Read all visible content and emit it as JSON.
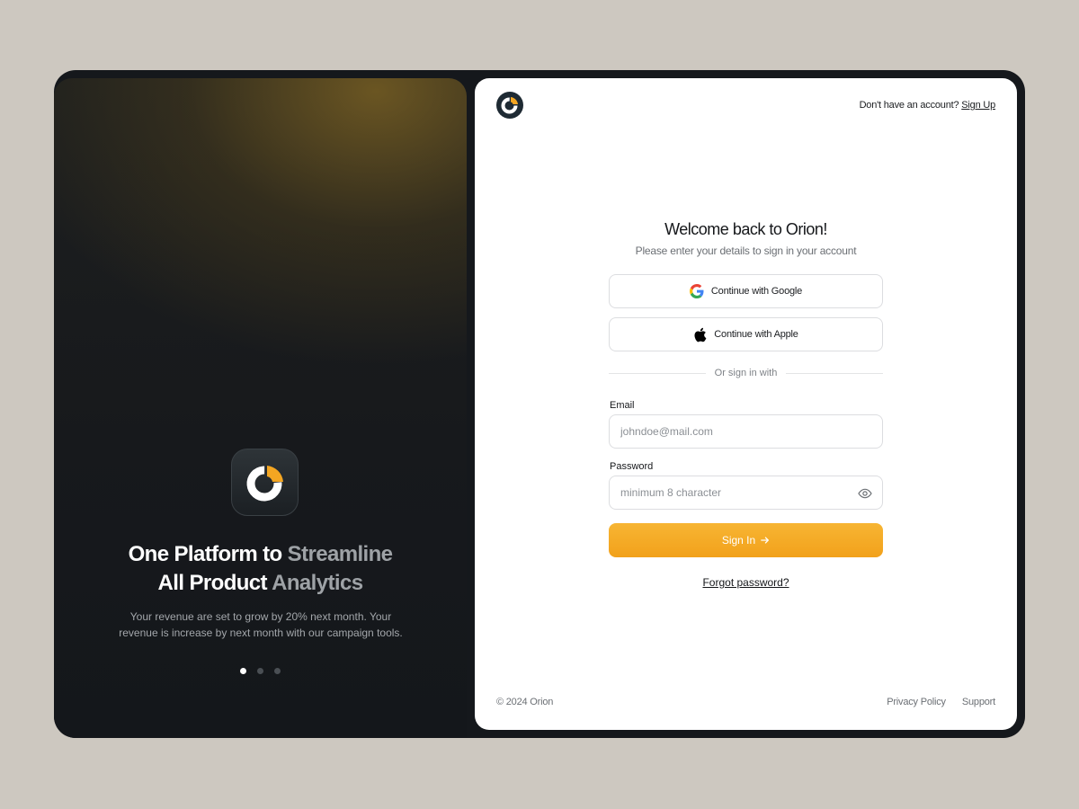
{
  "hero": {
    "headline_line1_a": "One Platform to",
    "headline_line1_b": "Streamline",
    "headline_line2_a": "All Product",
    "headline_line2_b": "Analytics",
    "description": "Your revenue are set to grow by 20% next month. Your revenue is increase by next month with our campaign tools.",
    "carousel_dots": 3,
    "carousel_active_index": 0
  },
  "header": {
    "signup_prompt": "Don't have an account?",
    "signup_link": "Sign Up"
  },
  "form": {
    "title": "Welcome back to Orion!",
    "subtitle": "Please enter your details to sign in your account",
    "google_label": "Continue with Google",
    "apple_label": "Continue with Apple",
    "divider_text": "Or sign in with",
    "email_label": "Email",
    "email_placeholder": "johndoe@mail.com",
    "password_label": "Password",
    "password_placeholder": "minimum 8 character",
    "submit_label": "Sign In",
    "forgot_label": "Forgot password?"
  },
  "footer": {
    "copyright": "© 2024 Orion",
    "privacy": "Privacy Policy",
    "support": "Support"
  },
  "colors": {
    "accent": "#f4a622",
    "dark": "#15181c",
    "logo_dark": "#1e2a33"
  },
  "icons": {
    "logo": "orion-logo-icon",
    "google": "google-icon",
    "apple": "apple-icon",
    "eye": "eye-icon",
    "arrow": "arrow-right-icon"
  }
}
